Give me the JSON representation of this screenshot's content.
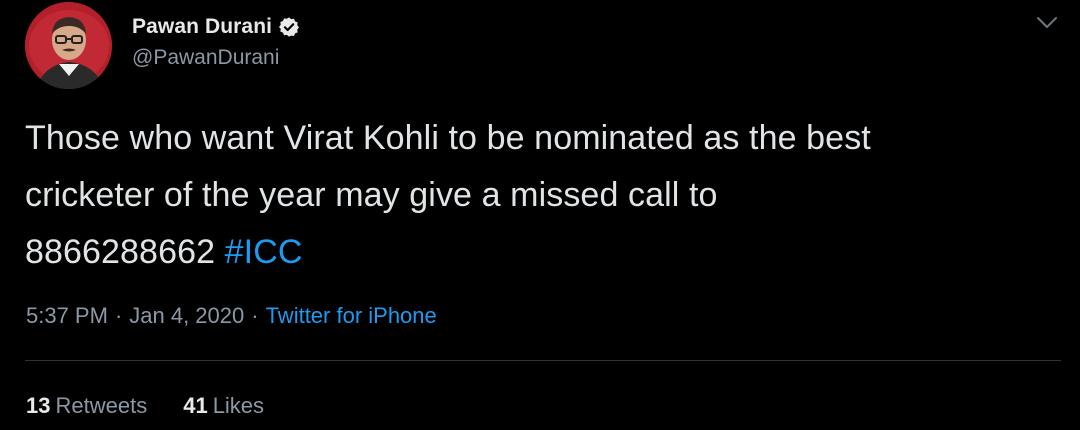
{
  "author": {
    "display_name": "Pawan Durani",
    "handle": "@PawanDurani",
    "verified": true,
    "avatar_icon": "profile-photo"
  },
  "tweet": {
    "text_lines": [
      "Those who want Virat Kohli to be nominated as the best",
      "cricketer of the year may give a missed call to"
    ],
    "text_last": "8866288662",
    "hashtag": "#ICC"
  },
  "meta": {
    "time": "5:37 PM",
    "separator": "·",
    "date": "Jan 4, 2020",
    "source": "Twitter for iPhone"
  },
  "stats": {
    "retweets_count": "13",
    "retweets_label": "Retweets",
    "likes_count": "41",
    "likes_label": "Likes"
  },
  "colors": {
    "background": "#000000",
    "accent": "#1d9bf0",
    "secondary_text": "#8b98a5",
    "primary_text": "#e1e4e6"
  }
}
